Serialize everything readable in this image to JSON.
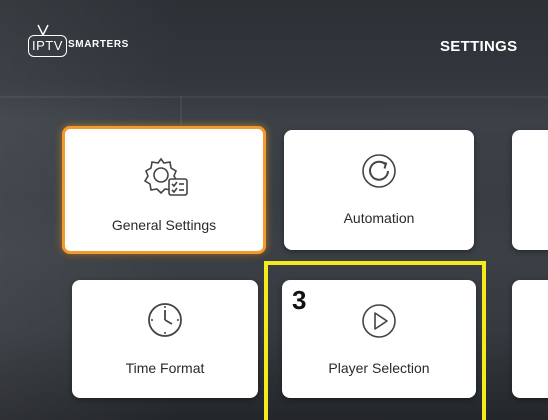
{
  "header": {
    "logo_iptv": "IPTV",
    "logo_smarters": "SMARTERS",
    "title": "SETTINGS"
  },
  "tiles": [
    {
      "label": "General Settings",
      "icon": "gear-checklist-icon",
      "selected": true
    },
    {
      "label": "Automation",
      "icon": "refresh-icon",
      "selected": false
    },
    {
      "label": "Time Format",
      "icon": "clock-icon",
      "selected": false
    },
    {
      "label": "Player Selection",
      "icon": "play-icon",
      "selected": false
    }
  ],
  "annotation": {
    "step_number": "3",
    "color": "#f4ea1c"
  },
  "colors": {
    "selected_border": "#f39a2e",
    "tile_bg": "#ffffff",
    "background": "#343a40"
  }
}
